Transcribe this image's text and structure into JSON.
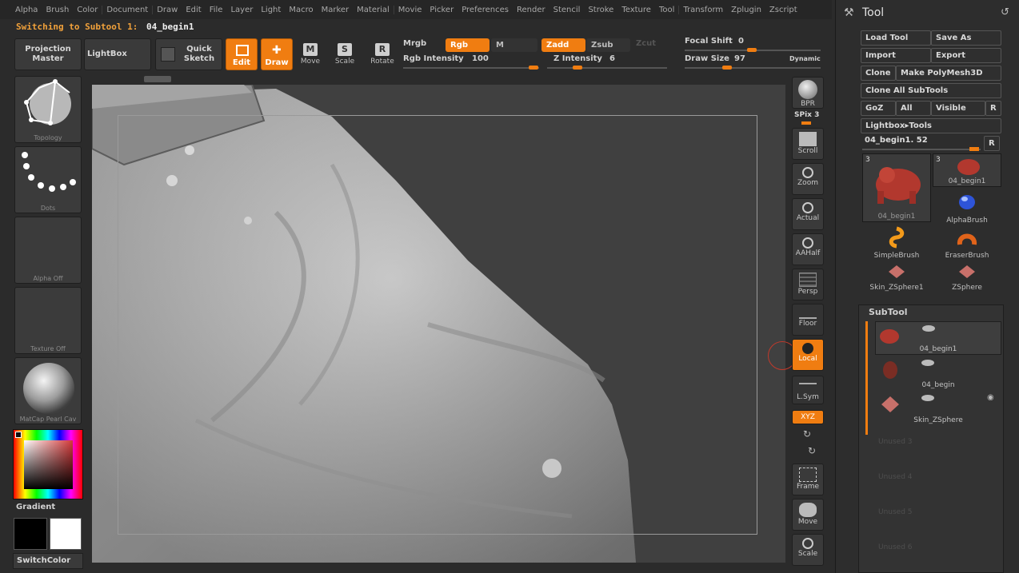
{
  "menu": [
    "Alpha",
    "Brush",
    "Color",
    "Document",
    "Draw",
    "Edit",
    "File",
    "Layer",
    "Light",
    "Macro",
    "Marker",
    "Material",
    "Movie",
    "Picker",
    "Preferences",
    "Render",
    "Stencil",
    "Stroke",
    "Texture",
    "Tool",
    "Transform",
    "Zplugin",
    "Zscript"
  ],
  "status": {
    "label": "Switching to Subtool 1:",
    "value": "04_begin1"
  },
  "toolbar": {
    "projection_master": "Projection Master",
    "lightbox": "LightBox",
    "quick_sketch": "Quick Sketch",
    "edit": "Edit",
    "draw": "Draw",
    "move": "Move",
    "scale": "Scale",
    "rotate": "Rotate",
    "move_glyph": "M",
    "scale_glyph": "S",
    "rotate_glyph": "R",
    "mrgb": "Mrgb",
    "rgb": "Rgb",
    "m": "M",
    "zadd": "Zadd",
    "zsub": "Zsub",
    "zcut": "Zcut",
    "rgb_intensity_label": "Rgb Intensity",
    "rgb_intensity": "100",
    "z_intensity_label": "Z Intensity",
    "z_intensity": "6",
    "focal_shift_label": "Focal Shift",
    "focal_shift": "0",
    "draw_size_label": "Draw Size",
    "draw_size": "97",
    "dynamic": "Dynamic"
  },
  "left_shelf": {
    "topology": "Topology",
    "dots": "Dots",
    "alpha_off": "Alpha Off",
    "texture_off": "Texture Off",
    "matcap": "MatCap Pearl Cav",
    "gradient": "Gradient",
    "switch_color": "SwitchColor",
    "colors": {
      "primary": "#000000",
      "secondary": "#ffffff"
    }
  },
  "right_shelf": {
    "bpr": "BPR",
    "spix": "SPix 3",
    "scroll": "Scroll",
    "zoom": "Zoom",
    "actual": "Actual",
    "aahalf": "AAHalf",
    "persp": "Persp",
    "floor": "Floor",
    "local": "Local",
    "lsym": "L.Sym",
    "xyz": "XYZ",
    "frame": "Frame",
    "move": "Move",
    "scale": "Scale"
  },
  "tool_panel": {
    "title": "Tool",
    "load_tool": "Load Tool",
    "save_as": "Save As",
    "import": "Import",
    "export": "Export",
    "clone": "Clone",
    "make_polymesh": "Make PolyMesh3D",
    "clone_all": "Clone All SubTools",
    "goz": "GoZ",
    "all": "All",
    "visible": "Visible",
    "r": "R",
    "lightbox_tools": "Lightbox▸Tools",
    "current_tool": "04_begin1. 52",
    "tools": [
      {
        "name": "04_begin1",
        "count": "3"
      },
      {
        "name": "04_begin1",
        "count": "3"
      },
      {
        "name": "AlphaBrush"
      },
      {
        "name": "SimpleBrush"
      },
      {
        "name": "EraserBrush"
      },
      {
        "name": "Skin_ZSphere1"
      },
      {
        "name": "ZSphere"
      }
    ]
  },
  "subtool": {
    "title": "SubTool",
    "items": [
      "04_begin1",
      "04_begin",
      "Skin_ZSphere"
    ],
    "unused": [
      "Unused 3",
      "Unused 4",
      "Unused 5",
      "Unused 6"
    ]
  }
}
